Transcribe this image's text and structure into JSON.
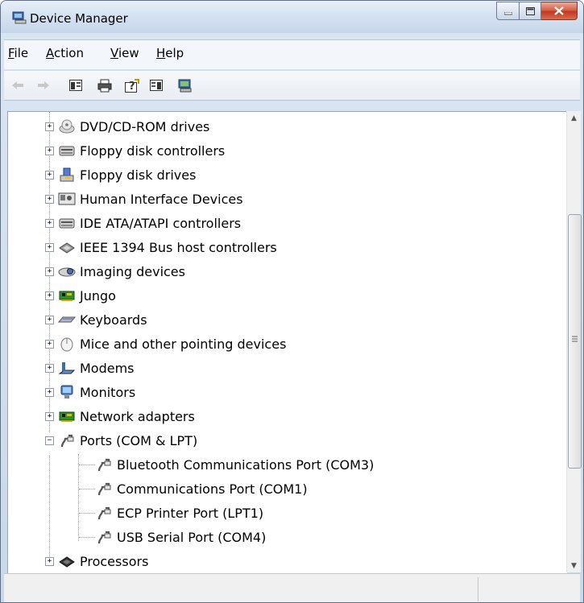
{
  "window": {
    "title": "Device Manager"
  },
  "menu": [
    {
      "label": "File",
      "accel": "F",
      "rest": "ile"
    },
    {
      "label": "Action",
      "accel": "A",
      "rest": "ction"
    },
    {
      "label": "View",
      "accel": "V",
      "rest": "iew"
    },
    {
      "label": "Help",
      "accel": "H",
      "rest": "elp"
    }
  ],
  "toolbar": [
    {
      "name": "back-arrow-icon"
    },
    {
      "name": "forward-arrow-icon"
    },
    {
      "name": "show-hide-console-tree-icon"
    },
    {
      "name": "print-icon"
    },
    {
      "name": "help-icon"
    },
    {
      "name": "show-action-pane-icon"
    },
    {
      "name": "scan-hardware-icon"
    }
  ],
  "tree": [
    {
      "label": "DVD/CD-ROM drives",
      "icon": "dvd-icon",
      "state": "collapsed"
    },
    {
      "label": "Floppy disk controllers",
      "icon": "controller-icon",
      "state": "collapsed"
    },
    {
      "label": "Floppy disk drives",
      "icon": "floppy-icon",
      "state": "collapsed"
    },
    {
      "label": "Human Interface Devices",
      "icon": "hid-icon",
      "state": "collapsed"
    },
    {
      "label": "IDE ATA/ATAPI controllers",
      "icon": "controller-icon",
      "state": "collapsed"
    },
    {
      "label": "IEEE 1394 Bus host controllers",
      "icon": "firewire-icon",
      "state": "collapsed"
    },
    {
      "label": "Imaging devices",
      "icon": "camera-icon",
      "state": "collapsed"
    },
    {
      "label": "Jungo",
      "icon": "board-icon",
      "state": "collapsed"
    },
    {
      "label": "Keyboards",
      "icon": "keyboard-icon",
      "state": "collapsed"
    },
    {
      "label": "Mice and other pointing devices",
      "icon": "mouse-icon",
      "state": "collapsed"
    },
    {
      "label": "Modems",
      "icon": "modem-icon",
      "state": "collapsed"
    },
    {
      "label": "Monitors",
      "icon": "monitor-icon",
      "state": "collapsed"
    },
    {
      "label": "Network adapters",
      "icon": "board-icon",
      "state": "collapsed"
    },
    {
      "label": "Ports (COM & LPT)",
      "icon": "port-icon",
      "state": "expanded",
      "children": [
        {
          "label": "Bluetooth Communications Port (COM3)",
          "icon": "port-icon"
        },
        {
          "label": "Communications Port (COM1)",
          "icon": "port-icon"
        },
        {
          "label": "ECP Printer Port (LPT1)",
          "icon": "port-icon"
        },
        {
          "label": "USB Serial Port (COM4)",
          "icon": "port-icon"
        }
      ]
    },
    {
      "label": "Processors",
      "icon": "processor-icon",
      "state": "collapsed"
    }
  ],
  "colors": {
    "title_bg": "#d3e0f0",
    "close_button": "#c1381d",
    "tree_bg": "#ffffff"
  }
}
